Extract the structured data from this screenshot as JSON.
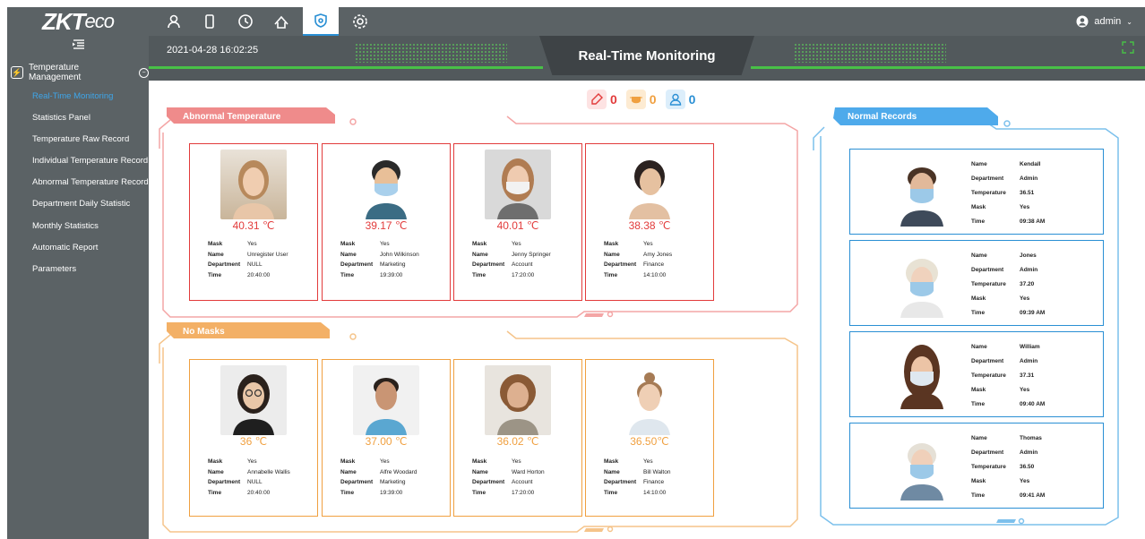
{
  "brand": {
    "logo_main": "ZKT",
    "logo_tail": "eco"
  },
  "topnav": [
    {
      "name": "personnel-icon"
    },
    {
      "name": "device-icon"
    },
    {
      "name": "attendance-icon"
    },
    {
      "name": "access-icon"
    },
    {
      "name": "temperature-icon"
    },
    {
      "name": "settings-icon"
    }
  ],
  "user": {
    "name": "admin"
  },
  "sidebar": {
    "section": "Temperature Management",
    "items": [
      {
        "label": "Real-Time Monitoring"
      },
      {
        "label": "Statistics Panel"
      },
      {
        "label": "Temperature Raw Record"
      },
      {
        "label": "Individual Temperature Record"
      },
      {
        "label": "Abnormal Temperature Record"
      },
      {
        "label": "Department Daily Statistic"
      },
      {
        "label": "Monthly Statistics"
      },
      {
        "label": "Automatic Report"
      },
      {
        "label": "Parameters"
      }
    ]
  },
  "header": {
    "datetime": "2021-04-28 16:02:25",
    "title": "Real-Time Monitoring"
  },
  "counters": {
    "abnormal": "0",
    "nomask": "0",
    "normal": "0"
  },
  "colors": {
    "abnormal": "#e23b3b",
    "nomask": "#f0a040",
    "normal": "#2a8fd4",
    "sidebar": "#5b6265",
    "active": "#3ea6ea"
  },
  "abnormal": {
    "title": "Abnormal Temperature",
    "cards": [
      {
        "temp": "40.31 ℃",
        "mask": "Yes",
        "name": "Unregister User",
        "department": "NULL",
        "time": "20:40:00"
      },
      {
        "temp": "39.17 ℃",
        "mask": "Yes",
        "name": "John Wilkinson",
        "department": "Marketing",
        "time": "19:39:00"
      },
      {
        "temp": "40.01 ℃",
        "mask": "Yes",
        "name": "Jenny Springer",
        "department": "Account",
        "time": "17:20:00"
      },
      {
        "temp": "38.38 ℃",
        "mask": "Yes",
        "name": "Amy Jones",
        "department": "Finance",
        "time": "14:10:00"
      }
    ]
  },
  "nomask": {
    "title": "No Masks",
    "cards": [
      {
        "temp": "36 ℃",
        "mask": "Yes",
        "name": "Annabelle Wallis",
        "department": "NULL",
        "time": "20:40:00"
      },
      {
        "temp": "37.00 ℃",
        "mask": "Yes",
        "name": "Alfre Woodard",
        "department": "Marketing",
        "time": "19:39:00"
      },
      {
        "temp": "36.02 ℃",
        "mask": "Yes",
        "name": "Ward Horton",
        "department": "Account",
        "time": "17:20:00"
      },
      {
        "temp": "36.50℃",
        "mask": "Yes",
        "name": "Bill Walton",
        "department": "Finance",
        "time": "14:10:00"
      }
    ]
  },
  "normal": {
    "title": "Normal Records",
    "cards": [
      {
        "name": "Kendall",
        "department": "Admin",
        "temperature": "36.51",
        "mask": "Yes",
        "time": "09:38 AM"
      },
      {
        "name": "Jones",
        "department": "Admin",
        "temperature": "37.20",
        "mask": "Yes",
        "time": "09:39 AM"
      },
      {
        "name": "William",
        "department": "Admin",
        "temperature": "37.31",
        "mask": "Yes",
        "time": "09:40 AM"
      },
      {
        "name": "Thomas",
        "department": "Admin",
        "temperature": "36.50",
        "mask": "Yes",
        "time": "09:41 AM"
      }
    ]
  },
  "labels": {
    "mask": "Mask",
    "name": "Name",
    "department": "Department",
    "time": "Time",
    "temperature": "Temperature"
  }
}
